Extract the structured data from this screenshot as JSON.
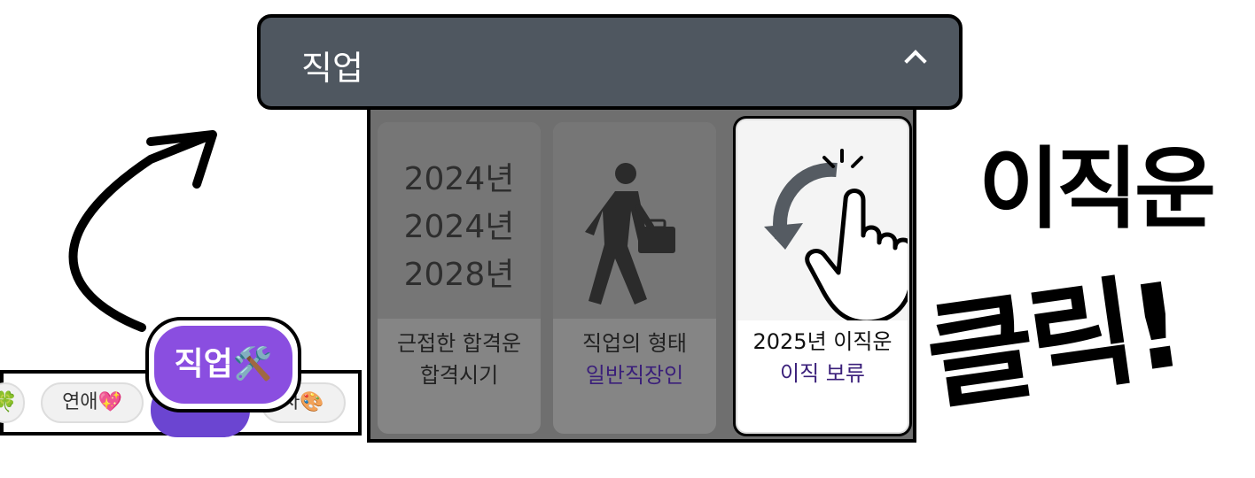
{
  "header": {
    "title": "직업"
  },
  "cards": [
    {
      "years": [
        "2024년",
        "2024년",
        "2028년"
      ],
      "line1": "근접한 합격운",
      "line2": "합격시기"
    },
    {
      "icon": "walking-businessman-icon",
      "line1": "직업의 형태",
      "line2": "일반직장인"
    },
    {
      "icon": "tap-hand-icon",
      "line1": "2025년 이직운",
      "line2": "이직 보류"
    }
  ],
  "tabs": {
    "items": [
      "🍀",
      "연애💖",
      "직업🛠️",
      "자🎨"
    ],
    "active_index": 2
  },
  "annotations": {
    "line1": "이직운",
    "line2": "클릭!"
  },
  "colors": {
    "header_bg": "#4f5760",
    "accent_purple": "#8a4ee0",
    "sub_text": "#3a1f7a"
  }
}
